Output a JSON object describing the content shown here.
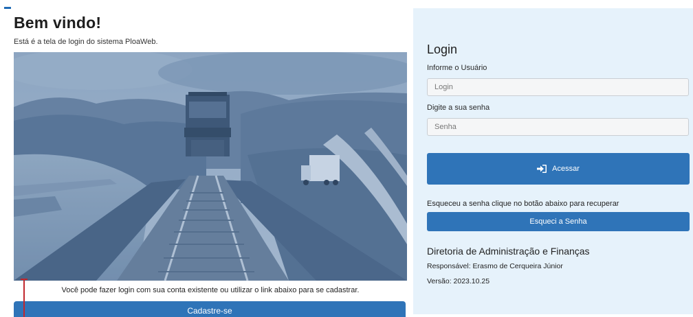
{
  "welcome": {
    "title": "Bem vindo!",
    "subtitle": "Está é a tela de login do sistema PloaWeb."
  },
  "hero": {
    "description": "photo-railway-bridge-train-truck"
  },
  "signup": {
    "info": "Você pode fazer login com sua conta existente ou utilizar o link abaixo para se cadastrar.",
    "button_label": "Cadastre-se"
  },
  "login": {
    "title": "Login",
    "user_label": "Informe o Usuário",
    "user_placeholder": "Login",
    "password_label": "Digite a sua senha",
    "password_placeholder": "Senha",
    "submit_label": "Acessar",
    "submit_icon": "sign-in-icon"
  },
  "recovery": {
    "text": "Esqueceu a senha clique no botão abaixo para recuperar",
    "button_label": "Esqueci a Senha"
  },
  "footer": {
    "department": "Diretoria de Administração e Finanças",
    "responsible": "Responsável: Erasmo de Cerqueira Júnior",
    "version": "Versão: 2023.10.25"
  },
  "colors": {
    "primary": "#2f74b8",
    "panel_bg": "#e6f2fb",
    "cursor": "#c1272d"
  }
}
